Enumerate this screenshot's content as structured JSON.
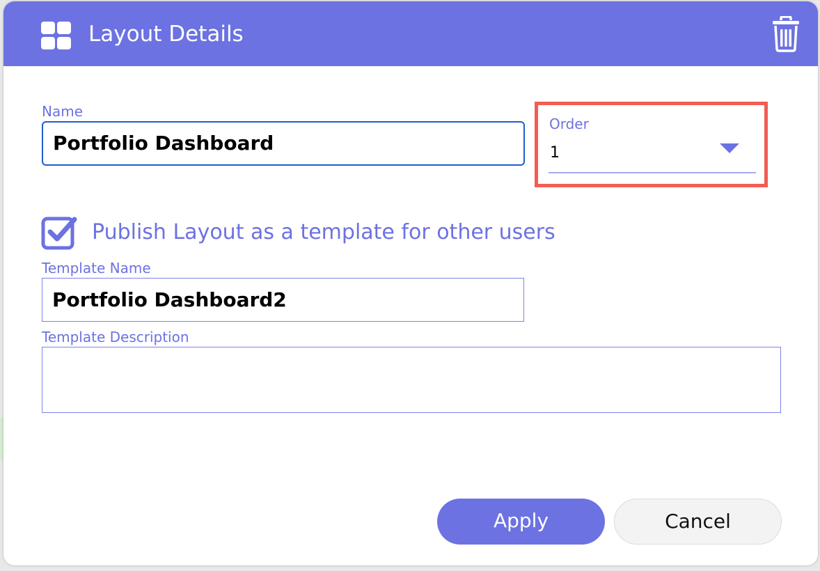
{
  "dialog": {
    "title": "Layout Details",
    "header_icon": "layout-grid-icon",
    "delete_icon": "trash-icon"
  },
  "form": {
    "name_label": "Name",
    "name_value": "Portfolio Dashboard",
    "order_label": "Order",
    "order_value": "1",
    "publish_checked": true,
    "publish_label": "Publish Layout as a template for other users",
    "template_name_label": "Template Name",
    "template_name_value": "Portfolio Dashboard2",
    "template_description_label": "Template Description",
    "template_description_value": ""
  },
  "actions": {
    "apply_label": "Apply",
    "cancel_label": "Cancel"
  },
  "colors": {
    "accent": "#6c72e1",
    "highlight": "#f25c54",
    "focus_border": "#1f5ec9"
  }
}
